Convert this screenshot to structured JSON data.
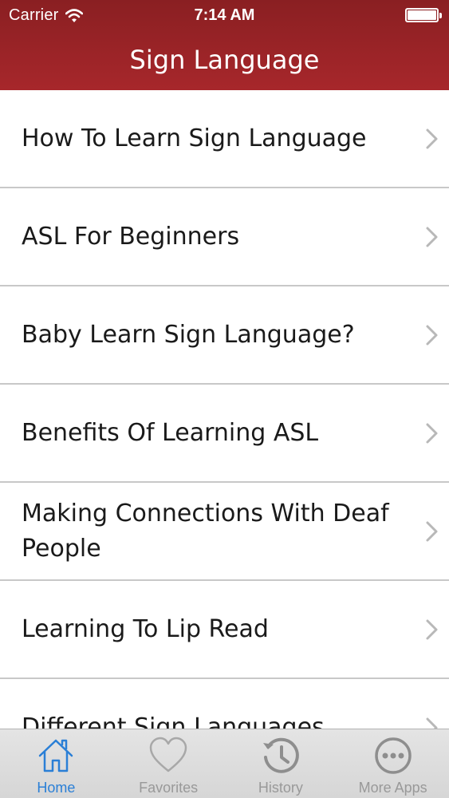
{
  "status_bar": {
    "carrier": "Carrier",
    "time": "7:14 AM"
  },
  "nav": {
    "title": "Sign Language"
  },
  "list": {
    "items": [
      {
        "label": "How To Learn Sign Language"
      },
      {
        "label": "ASL For Beginners"
      },
      {
        "label": "Baby Learn Sign Language?"
      },
      {
        "label": "Benefits Of Learning ASL"
      },
      {
        "label": "Making Connections With Deaf People"
      },
      {
        "label": "Learning To Lip Read"
      },
      {
        "label": "Different Sign Languages"
      }
    ]
  },
  "tabs": [
    {
      "label": "Home",
      "icon": "home-icon",
      "active": true
    },
    {
      "label": "Favorites",
      "icon": "heart-icon",
      "active": false
    },
    {
      "label": "History",
      "icon": "history-icon",
      "active": false
    },
    {
      "label": "More Apps",
      "icon": "more-icon",
      "active": false
    }
  ],
  "colors": {
    "header": "#a7272b",
    "active_tab": "#2a7fd6",
    "inactive_tab": "#999999"
  }
}
